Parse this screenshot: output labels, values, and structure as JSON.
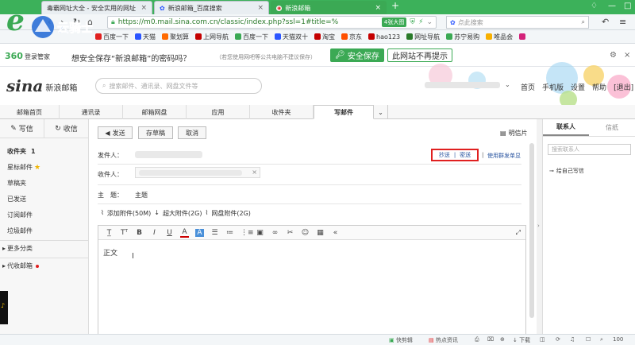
{
  "browser": {
    "tabs": [
      {
        "label": "毒霸网址大全 - 安全实用的网址",
        "active": false
      },
      {
        "label": "新浪邮箱_百度搜索",
        "active": false
      },
      {
        "label": "新浪邮箱",
        "active": true
      }
    ],
    "url": "https://m0.mail.sina.com.cn/classic/index.php?ssl=1#title=%",
    "big_image_label": "4张大图",
    "search_placeholder": "点此搜索",
    "bookmarks": [
      "百度一下",
      "天猫",
      "聚划算",
      "上网导航",
      "百度一下",
      "天猫双十",
      "淘宝",
      "京东",
      "hao123",
      "网址导航",
      "苏宁易购",
      "唯品会"
    ],
    "logo_text": "云骑士"
  },
  "notice": {
    "brand": "360",
    "brand_sub": "登录管家",
    "message": "想安全保存“新浪邮箱”的密码吗？",
    "hint": "（若您使用网吧等公共电脑不建议保存）",
    "save_button": "安全保存",
    "no_save_button": "此网站不再提示"
  },
  "mail_header": {
    "logo_main": "sina",
    "logo_sub": "新浪邮箱",
    "search_placeholder": "搜索邮件、通讯录、网盘文件等",
    "links": [
      "首页",
      "手机版",
      "设置",
      "帮助",
      "[退出]"
    ]
  },
  "main_tabs": [
    "邮箱首页",
    "通讯录",
    "邮箱网盘",
    "应用",
    "收件夹",
    "写邮件"
  ],
  "sidebar": {
    "write_label": "写信",
    "receive_label": "收信",
    "inbox_label": "收件夹",
    "inbox_count": "1",
    "items": [
      "星标邮件",
      "草稿夹",
      "已发送",
      "订阅邮件",
      "垃圾邮件"
    ],
    "more_label": "更多分类",
    "proxy_label": "代收邮箱"
  },
  "compose": {
    "send_button": "发送",
    "draft_button": "存草稿",
    "cancel_button": "取消",
    "postcard_label": "明信片",
    "sender_label": "发件人：",
    "recipient_label": "收件人：",
    "subject_label": "主　题：",
    "subject_value": "主题",
    "cc_label": "抄送",
    "bcc_label": "密送",
    "separator": "|",
    "individual_label": "使用群发单显",
    "attach": "添加附件(50M)",
    "super_attach": "超大附件(2G)",
    "cloud_attach": "网盘附件(2G)",
    "body_text": "正文"
  },
  "right_panel": {
    "tabs": [
      "联系人",
      "信纸"
    ],
    "search_placeholder": "搜索联系人",
    "self_mail": "给自己写信"
  },
  "status_bar": [
    "快剪辑",
    "热点资讯",
    "下载",
    "100"
  ],
  "colors": {
    "brand_green": "#3ba954",
    "highlight_red": "#e02020",
    "link_blue": "#2a55a0"
  }
}
